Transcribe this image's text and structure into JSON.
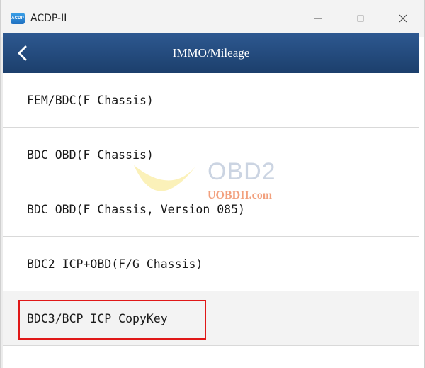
{
  "window": {
    "app_icon_text": "ACDP",
    "title": "ACDP-II",
    "minimize_icon": "minimize-icon",
    "maximize_icon": "maximize-icon",
    "close_icon": "close-icon"
  },
  "header": {
    "back_icon": "chevron-left-icon",
    "title": "IMMO/Mileage"
  },
  "list": {
    "items": [
      {
        "label": "FEM/BDC(F Chassis)"
      },
      {
        "label": "BDC OBD(F Chassis)"
      },
      {
        "label": "BDC OBD(F Chassis, Version 085)"
      },
      {
        "label": "BDC2 ICP+OBD(F/G Chassis)"
      },
      {
        "label": "BDC3/BCP ICP CopyKey"
      }
    ],
    "highlighted_index": 4
  },
  "watermark": {
    "text": "OBD2",
    "sub": "UOBDII.com"
  },
  "colors": {
    "header_bg": "#2d5890",
    "highlight_border": "#e01818",
    "titlebar_bg": "#f3f3f3"
  }
}
